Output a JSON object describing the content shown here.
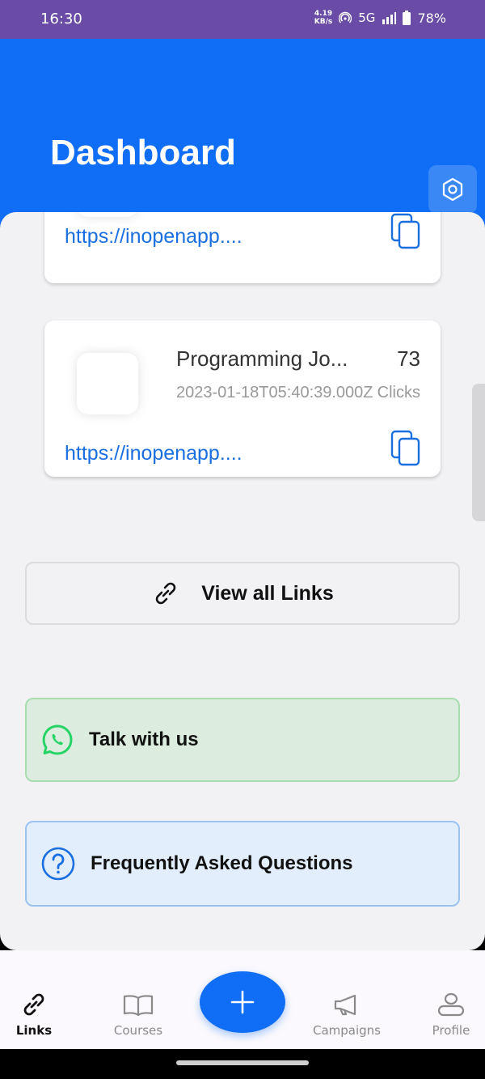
{
  "status_bar": {
    "time": "16:30",
    "net_speed_value": "4.19",
    "net_speed_unit": "KB/s",
    "network": "5G",
    "battery": "78%"
  },
  "header": {
    "title": "Dashboard",
    "settings_icon": "hexagon-settings-icon"
  },
  "links": [
    {
      "title": "",
      "count": "",
      "date": "",
      "clicks_label": "",
      "url": "https://inopenapp...."
    },
    {
      "title": "Programming Jo...",
      "count": "73",
      "date": "2023-01-18T05:40:39.000Z",
      "clicks_label": "Clicks",
      "url": "https://inopenapp...."
    }
  ],
  "view_all": {
    "label": "View all Links",
    "icon": "link-icon"
  },
  "talk": {
    "label": "Talk with us",
    "icon": "whatsapp-icon",
    "color": "#25d366"
  },
  "faq": {
    "label": "Frequently Asked Questions",
    "icon": "question-icon",
    "color": "#1a6fe0"
  },
  "nav": {
    "items": [
      {
        "label": "Links",
        "icon": "link-icon",
        "active": true
      },
      {
        "label": "Courses",
        "icon": "book-icon",
        "active": false
      },
      {
        "label": "Campaigns",
        "icon": "megaphone-icon",
        "active": false
      },
      {
        "label": "Profile",
        "icon": "user-icon",
        "active": false
      }
    ],
    "fab_icon": "plus-icon"
  },
  "colors": {
    "primary": "#0f6ef5",
    "status_bar": "#6a4ca6",
    "link_text": "#1a6fe0"
  }
}
